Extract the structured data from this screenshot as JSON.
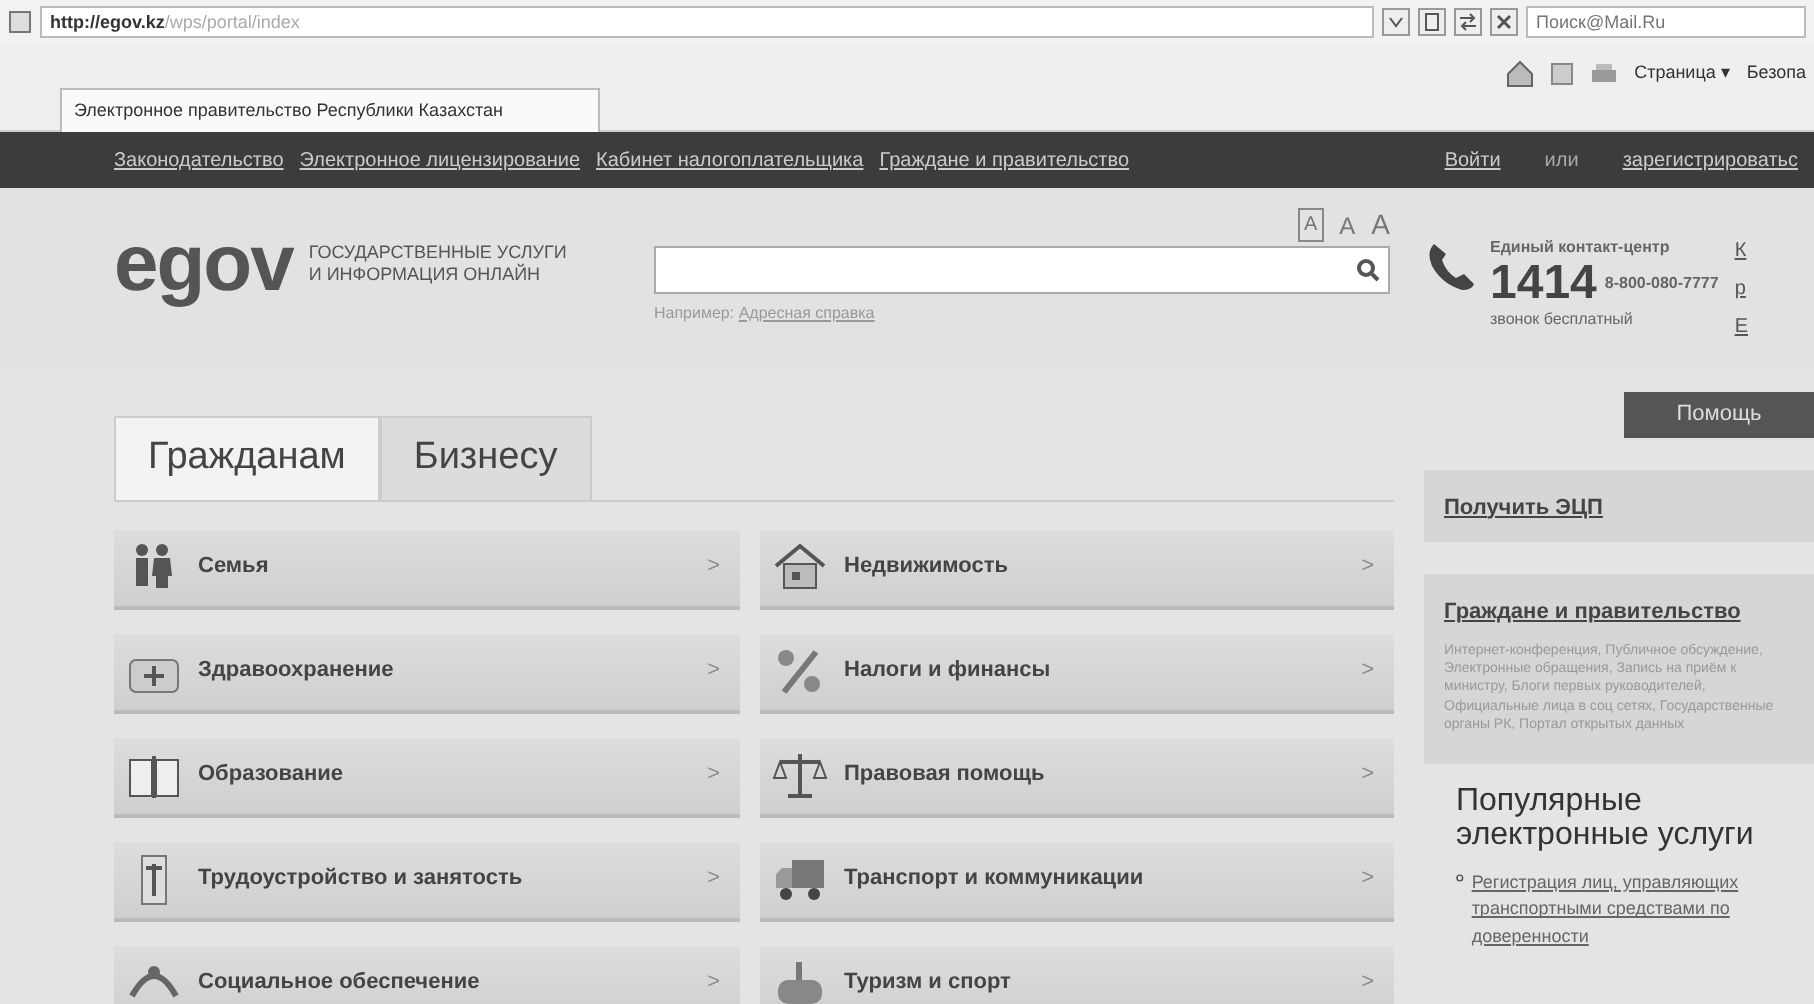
{
  "browser": {
    "address_host": "http://egov.kz",
    "address_path": "/wps/portal/index",
    "search_placeholder": "Поиск@Mail.Ru",
    "tab_title": "Электронное правительство Республики Казахстан",
    "toolbar": [
      "Страница ▾",
      "Безопа"
    ]
  },
  "top_nav": {
    "links": [
      "Законодательство",
      "Электронное лицензирование",
      "Кабинет налогоплательщика",
      "Граждане и правительство"
    ],
    "login": "Войти",
    "or": "или",
    "register": "зарегистрироватьс"
  },
  "font_sizes": [
    {
      "label": "A",
      "selected": true
    },
    {
      "label": "A",
      "selected": false
    },
    {
      "label": "A",
      "selected": false
    }
  ],
  "logo": {
    "text": "egov",
    "tagline": "ГОСУДАРСТВЕННЫЕ УСЛУГИ\nИ ИНФОРМАЦИЯ ОНЛАЙН"
  },
  "search": {
    "example_label": "Например:",
    "example_link": "Адресная справка"
  },
  "contact": {
    "title": "Единый контакт-центр",
    "short_number": "1414",
    "phone": "8-800-080-7777",
    "note": "звонок бесплатный"
  },
  "languages": [
    "К",
    "р",
    "E"
  ],
  "tabs": [
    {
      "label": "Гражданам",
      "selected": true
    },
    {
      "label": "Бизнесу",
      "selected": false
    }
  ],
  "categories": [
    {
      "label": "Семья",
      "kind": "family"
    },
    {
      "label": "Недвижимость",
      "kind": "house"
    },
    {
      "label": "Здравоохранение",
      "kind": "health"
    },
    {
      "label": "Налоги и финансы",
      "kind": "percent"
    },
    {
      "label": "Образование",
      "kind": "book"
    },
    {
      "label": "Правовая помощь",
      "kind": "scales"
    },
    {
      "label": "Трудоустройство и занятость",
      "kind": "worker"
    },
    {
      "label": "Транспорт и коммуникации",
      "kind": "truck"
    },
    {
      "label": "Социальное обеспечение",
      "kind": "social"
    },
    {
      "label": "Туризм и спорт",
      "kind": "tourism"
    }
  ],
  "category_arrow": ">",
  "sidebar": {
    "help_button": "Помощь",
    "ecp_link": "Получить ЭЦП",
    "gov_title": "Граждане и правительство",
    "gov_text": "Интернет-конференция, Публичное обсуждение, Электронные обращения, Запись на приём к министру, Блоги первых руководителей, Официальные лица в соц сетях, Государственные органы РК, Портал открытых данных",
    "popular_title": "Популярные электронные услуги",
    "popular": [
      "Регистрация лиц, управляющих транспортными средствами по доверенности"
    ]
  }
}
